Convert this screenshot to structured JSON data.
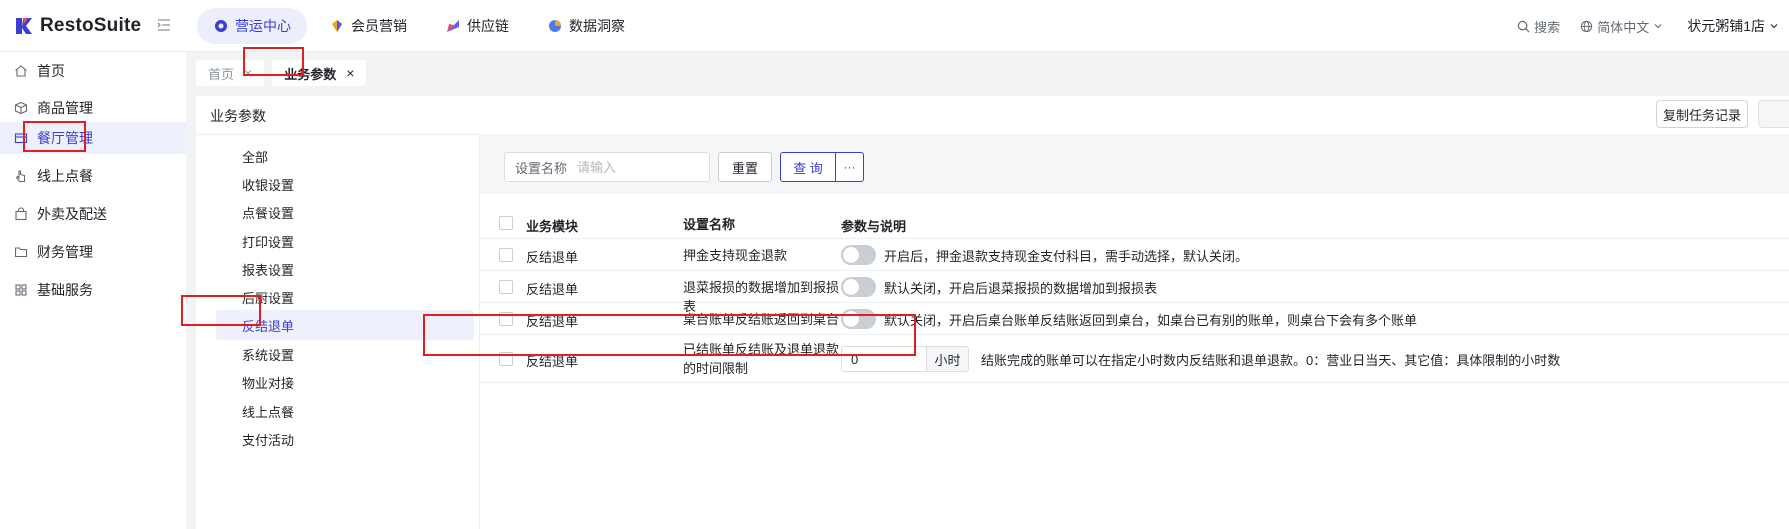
{
  "app": {
    "name": "RestoSuite"
  },
  "top_nav": [
    {
      "label": "营运中心",
      "active": true,
      "icon": "operations-icon"
    },
    {
      "label": "会员营销",
      "active": false,
      "icon": "member-icon"
    },
    {
      "label": "供应链",
      "active": false,
      "icon": "supply-icon"
    },
    {
      "label": "数据洞察",
      "active": false,
      "icon": "data-icon"
    }
  ],
  "top_right": {
    "search": "搜索",
    "language": "简体中文",
    "store": "状元粥铺1店"
  },
  "sidebar": {
    "items": [
      {
        "label": "首页",
        "icon": "home-icon"
      },
      {
        "label": "商品管理",
        "icon": "box-icon"
      },
      {
        "label": "餐厅管理",
        "icon": "store-icon",
        "active": true
      },
      {
        "label": "线上点餐",
        "icon": "pointer-icon"
      },
      {
        "label": "外卖及配送",
        "icon": "bag-icon"
      },
      {
        "label": "财务管理",
        "icon": "folder-icon"
      },
      {
        "label": "基础服务",
        "icon": "grid-icon"
      }
    ]
  },
  "tabs": [
    {
      "label": "首页",
      "active": false
    },
    {
      "label": "业务参数",
      "active": true
    }
  ],
  "panel": {
    "title": "业务参数",
    "copy_button": "复制任务记录"
  },
  "categories": [
    {
      "label": "全部"
    },
    {
      "label": "收银设置"
    },
    {
      "label": "点餐设置"
    },
    {
      "label": "打印设置"
    },
    {
      "label": "报表设置"
    },
    {
      "label": "后厨设置"
    },
    {
      "label": "反结退单",
      "active": true
    },
    {
      "label": "系统设置"
    },
    {
      "label": "物业对接"
    },
    {
      "label": "线上点餐"
    },
    {
      "label": "支付活动"
    }
  ],
  "filter": {
    "field_label": "设置名称",
    "placeholder": "请输入",
    "reset": "重置",
    "query": "查 询",
    "more": "···"
  },
  "table": {
    "headers": {
      "module": "业务模块",
      "name": "设置名称",
      "param": "参数与说明"
    },
    "rows": [
      {
        "module": "反结退单",
        "name": "押金支持现金退款",
        "type": "toggle",
        "on": false,
        "desc": "开启后，押金退款支持现金支付科目，需手动选择，默认关闭。"
      },
      {
        "module": "反结退单",
        "name": "退菜报损的数据增加到报损表",
        "type": "toggle",
        "on": false,
        "desc": "默认关闭，开启后退菜报损的数据增加到报损表"
      },
      {
        "module": "反结退单",
        "name": "桌台账单反结账返回到桌台",
        "type": "toggle",
        "on": false,
        "desc": "默认关闭，开启后桌台账单反结账返回到桌台，如桌台已有别的账单，则桌台下会有多个账单"
      },
      {
        "module": "反结退单",
        "name": "已结账单反结账及退单退款的时间限制",
        "type": "number",
        "value": "0",
        "unit": "小时",
        "desc": "结账完成的账单可以在指定小时数内反结账和退单退款。0：营业日当天、其它值：具体限制的小时数"
      }
    ]
  },
  "colors": {
    "accent": "#3b3fce",
    "highlight": "#e02020"
  }
}
